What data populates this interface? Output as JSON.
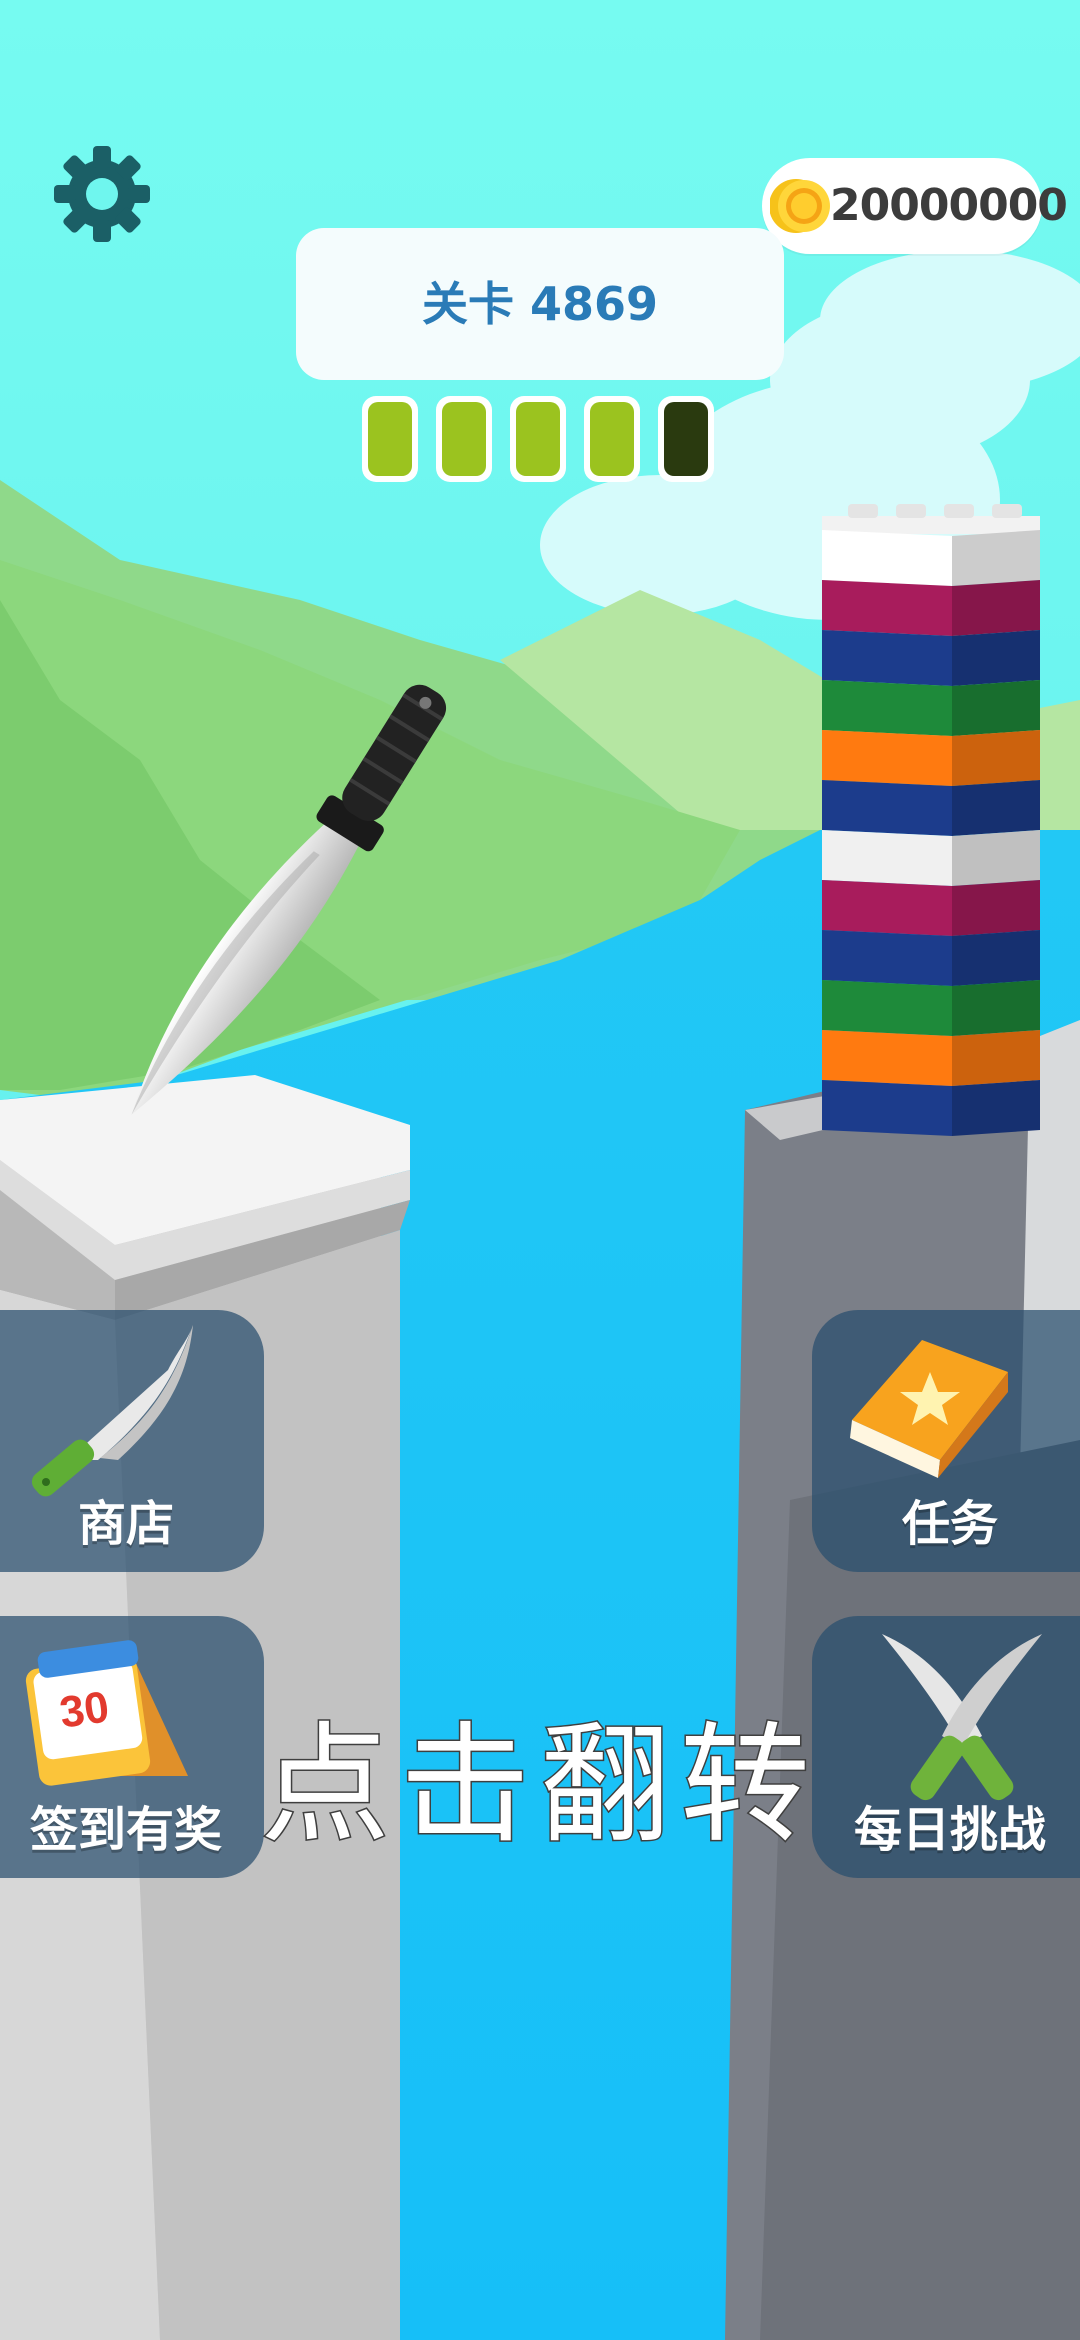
{
  "hud": {
    "coins": "20000000",
    "level_label": "关卡 4869",
    "stage_progress": {
      "total": 5,
      "completed": 4
    },
    "colors": {
      "segment_done": "#9bc31f",
      "segment_pending": "#2a3a0f",
      "segment_border": "#ffffff"
    }
  },
  "menu": {
    "shop": {
      "label": "商店",
      "icon": "knife-icon"
    },
    "tasks": {
      "label": "任务",
      "icon": "star-book-icon"
    },
    "checkin": {
      "label": "签到有奖",
      "icon": "calendar-icon",
      "calendar_number": "30"
    },
    "daily": {
      "label": "每日挑战",
      "icon": "crossed-knives-icon"
    }
  },
  "hint": {
    "text": "点击翻转"
  },
  "icons": {
    "settings": "gear-icon",
    "coin": "coin-icon"
  },
  "scene": {
    "tower_colors": [
      "#ffffff",
      "#a81c5c",
      "#1c3c8c",
      "#1e8a3a",
      "#ff7a10",
      "#1c3c8c",
      "#f0f0f0",
      "#a81c5c",
      "#1c3c8c",
      "#1e8a3a",
      "#ff7a10",
      "#1c3c8c"
    ]
  }
}
